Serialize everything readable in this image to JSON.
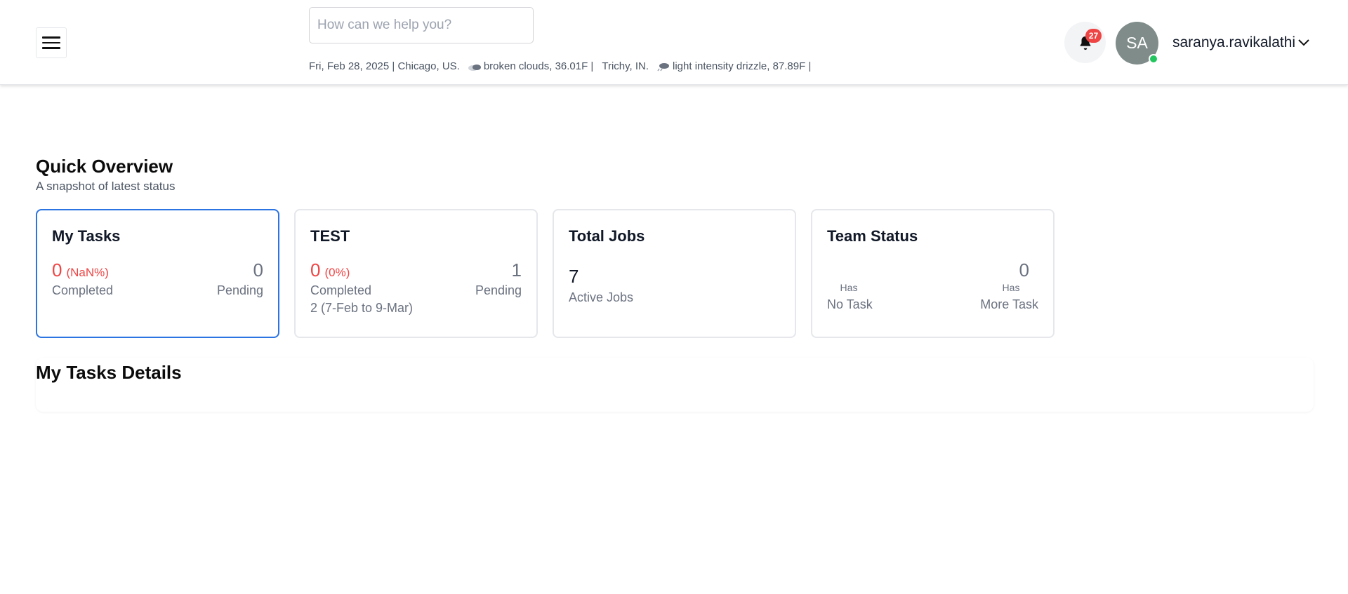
{
  "header": {
    "search_placeholder": "How can we help you?",
    "weather": {
      "date_location": "Fri, Feb 28, 2025 | Chicago, US.",
      "chicago_weather": "broken clouds, 36.01F |",
      "trichy_location": "Trichy, IN.",
      "trichy_weather": "light intensity drizzle, 87.89F |"
    },
    "notification_count": "27",
    "avatar_initials": "SA",
    "username": "saranya.ravikalathi",
    "icons": [
      "hamburger-menu-icon",
      "cloud-icon",
      "drizzle-icon",
      "bell-icon",
      "chevron-down-icon"
    ]
  },
  "overview": {
    "title": "Quick Overview",
    "subtitle": "A snapshot of latest status"
  },
  "cards": {
    "my_tasks": {
      "title": "My Tasks",
      "completed_value": "0",
      "completed_pct": "(NaN%)",
      "pending_value": "0",
      "completed_label": "Completed",
      "pending_label": "Pending"
    },
    "test": {
      "title": "TEST",
      "completed_value": "0",
      "completed_pct": "(0%)",
      "pending_value": "1",
      "completed_label": "Completed",
      "pending_label": "Pending",
      "range_note": "2 (7-Feb to 9-Mar)"
    },
    "total_jobs": {
      "title": "Total Jobs",
      "value": "7",
      "label": "Active Jobs"
    },
    "team_status": {
      "title": "Team Status",
      "more_task_value": "0",
      "has_left": "Has",
      "has_right": "Has",
      "no_task_label": "No Task",
      "more_task_label": "More Task"
    }
  },
  "details": {
    "title": "My Tasks Details"
  },
  "colors": {
    "accent_blue": "#2b74e2",
    "alert_red": "#ef4444",
    "online_green": "#22c55e",
    "avatar_bg": "#7f8c8a"
  }
}
